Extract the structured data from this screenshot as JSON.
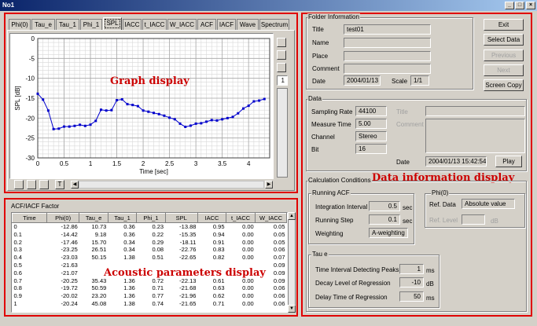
{
  "window": {
    "title": "No1"
  },
  "tabs": [
    {
      "label": "Phi(0)"
    },
    {
      "label": "Tau_e"
    },
    {
      "label": "Tau_1"
    },
    {
      "label": "Phi_1"
    },
    {
      "label": "SPL"
    },
    {
      "label": "IACC"
    },
    {
      "label": "t_IACC"
    },
    {
      "label": "W_IACC"
    },
    {
      "label": "ACF"
    },
    {
      "label": "IACF"
    },
    {
      "label": "Wave"
    },
    {
      "label": "Spectrum"
    }
  ],
  "annotations": {
    "graph": "Graph display",
    "acoustic": "Acoustic parameters display",
    "data_info": "Data information display"
  },
  "graph_side": {
    "page_value": "1"
  },
  "graph_toolbar": {
    "mode_label": "T"
  },
  "chart_data": {
    "type": "line",
    "title": "",
    "xlabel": "Time [sec]",
    "ylabel": "SPL [dB]",
    "xlim": [
      0,
      4.4
    ],
    "ylim": [
      -30,
      0
    ],
    "xticks": [
      "0",
      "0.5",
      "1",
      "1.5",
      "2",
      "2.5",
      "3",
      "3.5",
      "4"
    ],
    "yticks": [
      "0",
      "-5",
      "-10",
      "-15",
      "-20",
      "-25",
      "-30"
    ],
    "grid": true,
    "x": [
      0,
      0.1,
      0.2,
      0.3,
      0.4,
      0.5,
      0.6,
      0.7,
      0.8,
      0.9,
      1.0,
      1.1,
      1.2,
      1.3,
      1.4,
      1.5,
      1.6,
      1.7,
      1.8,
      1.9,
      2.0,
      2.1,
      2.2,
      2.3,
      2.4,
      2.5,
      2.6,
      2.7,
      2.8,
      2.9,
      3.0,
      3.1,
      3.2,
      3.3,
      3.4,
      3.5,
      3.6,
      3.7,
      3.8,
      3.9,
      4.0,
      4.1,
      4.2,
      4.3
    ],
    "values": [
      -13.88,
      -15.35,
      -18.11,
      -22.76,
      -22.65,
      -22.13,
      -22.13,
      -21.96,
      -21.68,
      -21.96,
      -21.65,
      -20.7,
      -17.9,
      -18.1,
      -18.0,
      -15.5,
      -15.3,
      -16.5,
      -16.7,
      -17.0,
      -18.1,
      -18.4,
      -18.7,
      -19.0,
      -19.4,
      -19.9,
      -20.3,
      -21.4,
      -22.2,
      -21.9,
      -21.4,
      -21.3,
      -20.9,
      -20.5,
      -20.6,
      -20.3,
      -20.0,
      -19.7,
      -18.8,
      -17.6,
      -16.9,
      -15.8,
      -15.6,
      -15.2
    ]
  },
  "acf_panel": {
    "title": "ACF/IACF Factor",
    "columns": [
      "Time",
      "Phi(0)",
      "Tau_e",
      "Tau_1",
      "Phi_1",
      "SPL",
      "IACC",
      "t_IACC",
      "W_IACC"
    ],
    "rows": [
      [
        "0",
        "-12.86",
        "10.73",
        "0.36",
        "0.23",
        "-13.88",
        "0.95",
        "0.00",
        "0.05"
      ],
      [
        "0.1",
        "-14.42",
        "9.18",
        "0.36",
        "0.22",
        "-15.35",
        "0.94",
        "0.00",
        "0.05"
      ],
      [
        "0.2",
        "-17.46",
        "15.70",
        "0.34",
        "0.29",
        "-18.11",
        "0.91",
        "0.00",
        "0.05"
      ],
      [
        "0.3",
        "-23.25",
        "26.51",
        "0.34",
        "0.08",
        "-22.76",
        "0.83",
        "0.00",
        "0.06"
      ],
      [
        "0.4",
        "-23.03",
        "50.15",
        "1.38",
        "0.51",
        "-22.65",
        "0.82",
        "0.00",
        "0.07"
      ],
      [
        "0.5",
        "-21.63",
        "",
        "",
        "",
        "",
        "",
        "",
        "0.09"
      ],
      [
        "0.6",
        "-21.07",
        "",
        "",
        "",
        "",
        "",
        "",
        "0.09"
      ],
      [
        "0.7",
        "-20.25",
        "35.43",
        "1.36",
        "0.72",
        "-22.13",
        "0.61",
        "0.00",
        "0.09"
      ],
      [
        "0.8",
        "-19.72",
        "50.59",
        "1.36",
        "0.71",
        "-21.68",
        "0.63",
        "0.00",
        "0.06"
      ],
      [
        "0.9",
        "-20.02",
        "23.20",
        "1.36",
        "0.77",
        "-21.96",
        "0.62",
        "0.00",
        "0.06"
      ],
      [
        "1",
        "-20.24",
        "45.08",
        "1.38",
        "0.74",
        "-21.65",
        "0.71",
        "0.00",
        "0.06"
      ]
    ]
  },
  "folder": {
    "title": "Folder Information",
    "title_label": "Title",
    "title_value": "test01",
    "name_label": "Name",
    "name_value": "",
    "place_label": "Place",
    "place_value": "",
    "comment_label": "Comment",
    "comment_value": "",
    "date_label": "Date",
    "date_value": "2004/01/13",
    "scale_label": "Scale",
    "scale_value": "1/1"
  },
  "buttons": {
    "exit": "Exit",
    "select_data": "Select Data",
    "previous": "Previous",
    "next": "Next",
    "screen_copy": "Screen Copy",
    "play": "Play"
  },
  "data": {
    "title": "Data",
    "sampling_rate_label": "Sampling Rate",
    "sampling_rate": "44100",
    "measure_time_label": "Measure Time",
    "measure_time": "5.00",
    "channel_label": "Channel",
    "channel": "Stereo",
    "bit_label": "Bit",
    "bit": "16",
    "title_label": "Title",
    "comment_label": "Comment",
    "date_label": "Date",
    "date_value": "2004/01/13 15:42:54"
  },
  "calc": {
    "title": "Calculation Conditions",
    "running_acf": {
      "title": "Running ACF",
      "integration_label": "Integration Interval",
      "integration_value": "0.5",
      "integration_unit": "sec",
      "step_label": "Running Step",
      "step_value": "0.1",
      "step_unit": "sec",
      "weighting_label": "Weighting",
      "weighting_value": "A-weighting"
    },
    "phi0": {
      "title": "Phi(0)",
      "ref_data_label": "Ref. Data",
      "ref_data_value": "Absolute value",
      "ref_level_label": "Ref. Level",
      "ref_level_unit": "dB"
    },
    "taue": {
      "title": "Tau e",
      "peaks_label": "Time Interval Detecting Peaks",
      "peaks_value": "1",
      "peaks_unit": "ms",
      "decay_label": "Decay Level of Regression",
      "decay_value": "-10",
      "decay_unit": "dB",
      "delay_label": "Delay Time of Regression",
      "delay_value": "50",
      "delay_unit": "ms"
    }
  }
}
